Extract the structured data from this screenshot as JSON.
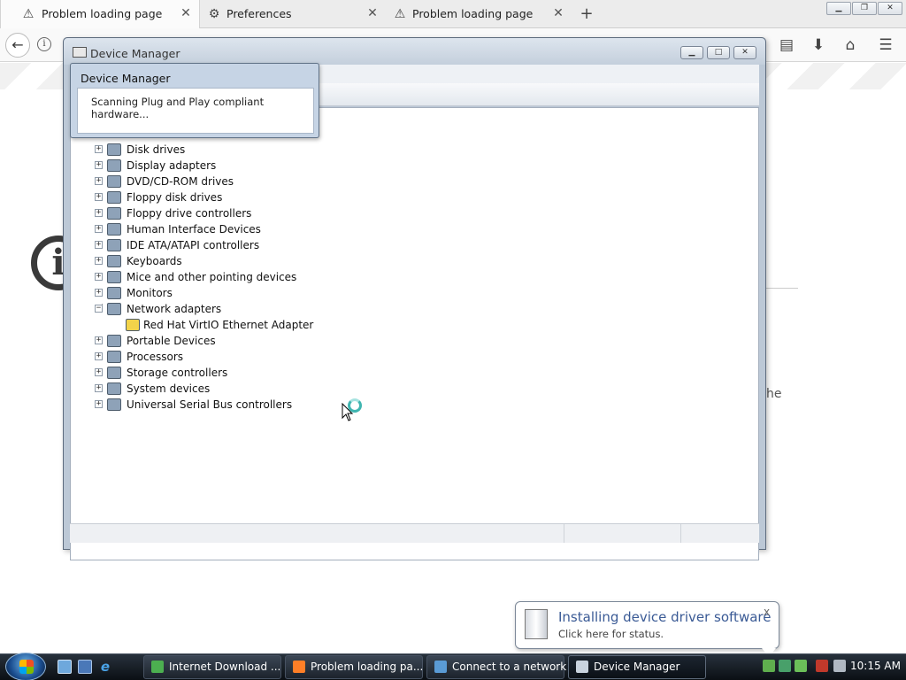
{
  "browser": {
    "tabs": [
      {
        "label": "Problem loading page",
        "icon": "warning-icon",
        "active": true
      },
      {
        "label": "Preferences",
        "icon": "gear-icon",
        "active": false
      },
      {
        "label": "Problem loading page",
        "icon": "warning-icon",
        "active": false
      }
    ],
    "page_text_fragment": "he"
  },
  "device_manager": {
    "window_title": "Device Manager",
    "tree_items": [
      {
        "label": "Disk drives",
        "icon": "disk-drive-icon",
        "expander": "+"
      },
      {
        "label": "Display adapters",
        "icon": "display-adapter-icon",
        "expander": "+"
      },
      {
        "label": "DVD/CD-ROM drives",
        "icon": "dvd-drive-icon",
        "expander": "+"
      },
      {
        "label": "Floppy disk drives",
        "icon": "floppy-drive-icon",
        "expander": "+"
      },
      {
        "label": "Floppy drive controllers",
        "icon": "floppy-controller-icon",
        "expander": "+"
      },
      {
        "label": "Human Interface Devices",
        "icon": "hid-icon",
        "expander": "+"
      },
      {
        "label": "IDE ATA/ATAPI controllers",
        "icon": "ide-controller-icon",
        "expander": "+"
      },
      {
        "label": "Keyboards",
        "icon": "keyboard-icon",
        "expander": "+"
      },
      {
        "label": "Mice and other pointing devices",
        "icon": "mouse-icon",
        "expander": "+"
      },
      {
        "label": "Monitors",
        "icon": "monitor-icon",
        "expander": "+"
      },
      {
        "label": "Network adapters",
        "icon": "network-adapter-icon",
        "expander": "−"
      },
      {
        "label": "Red Hat VirtIO Ethernet Adapter",
        "icon": "warning-adapter-icon",
        "expander": ""
      },
      {
        "label": "Portable Devices",
        "icon": "portable-device-icon",
        "expander": "+"
      },
      {
        "label": "Processors",
        "icon": "processor-icon",
        "expander": "+"
      },
      {
        "label": "Storage controllers",
        "icon": "storage-controller-icon",
        "expander": "+"
      },
      {
        "label": "System devices",
        "icon": "system-device-icon",
        "expander": "+"
      },
      {
        "label": "Universal Serial Bus controllers",
        "icon": "usb-icon",
        "expander": "+"
      }
    ]
  },
  "scan_popup": {
    "title": "Device Manager",
    "text": "Scanning Plug and Play compliant hardware..."
  },
  "notification": {
    "title": "Installing device driver software",
    "subtitle": "Click here for status.",
    "close": "x"
  },
  "taskbar": {
    "items": [
      {
        "label": "Internet Download ...",
        "icon": "idm-icon",
        "color": "#4caf50"
      },
      {
        "label": "Problem loading pa...",
        "icon": "firefox-icon",
        "color": "#ff7f27"
      },
      {
        "label": "Connect to a network",
        "icon": "network-icon",
        "color": "#5a9bd5"
      },
      {
        "label": "Device Manager",
        "icon": "device-manager-icon",
        "color": "#c9d3de"
      }
    ],
    "clock": "10:15 AM"
  }
}
